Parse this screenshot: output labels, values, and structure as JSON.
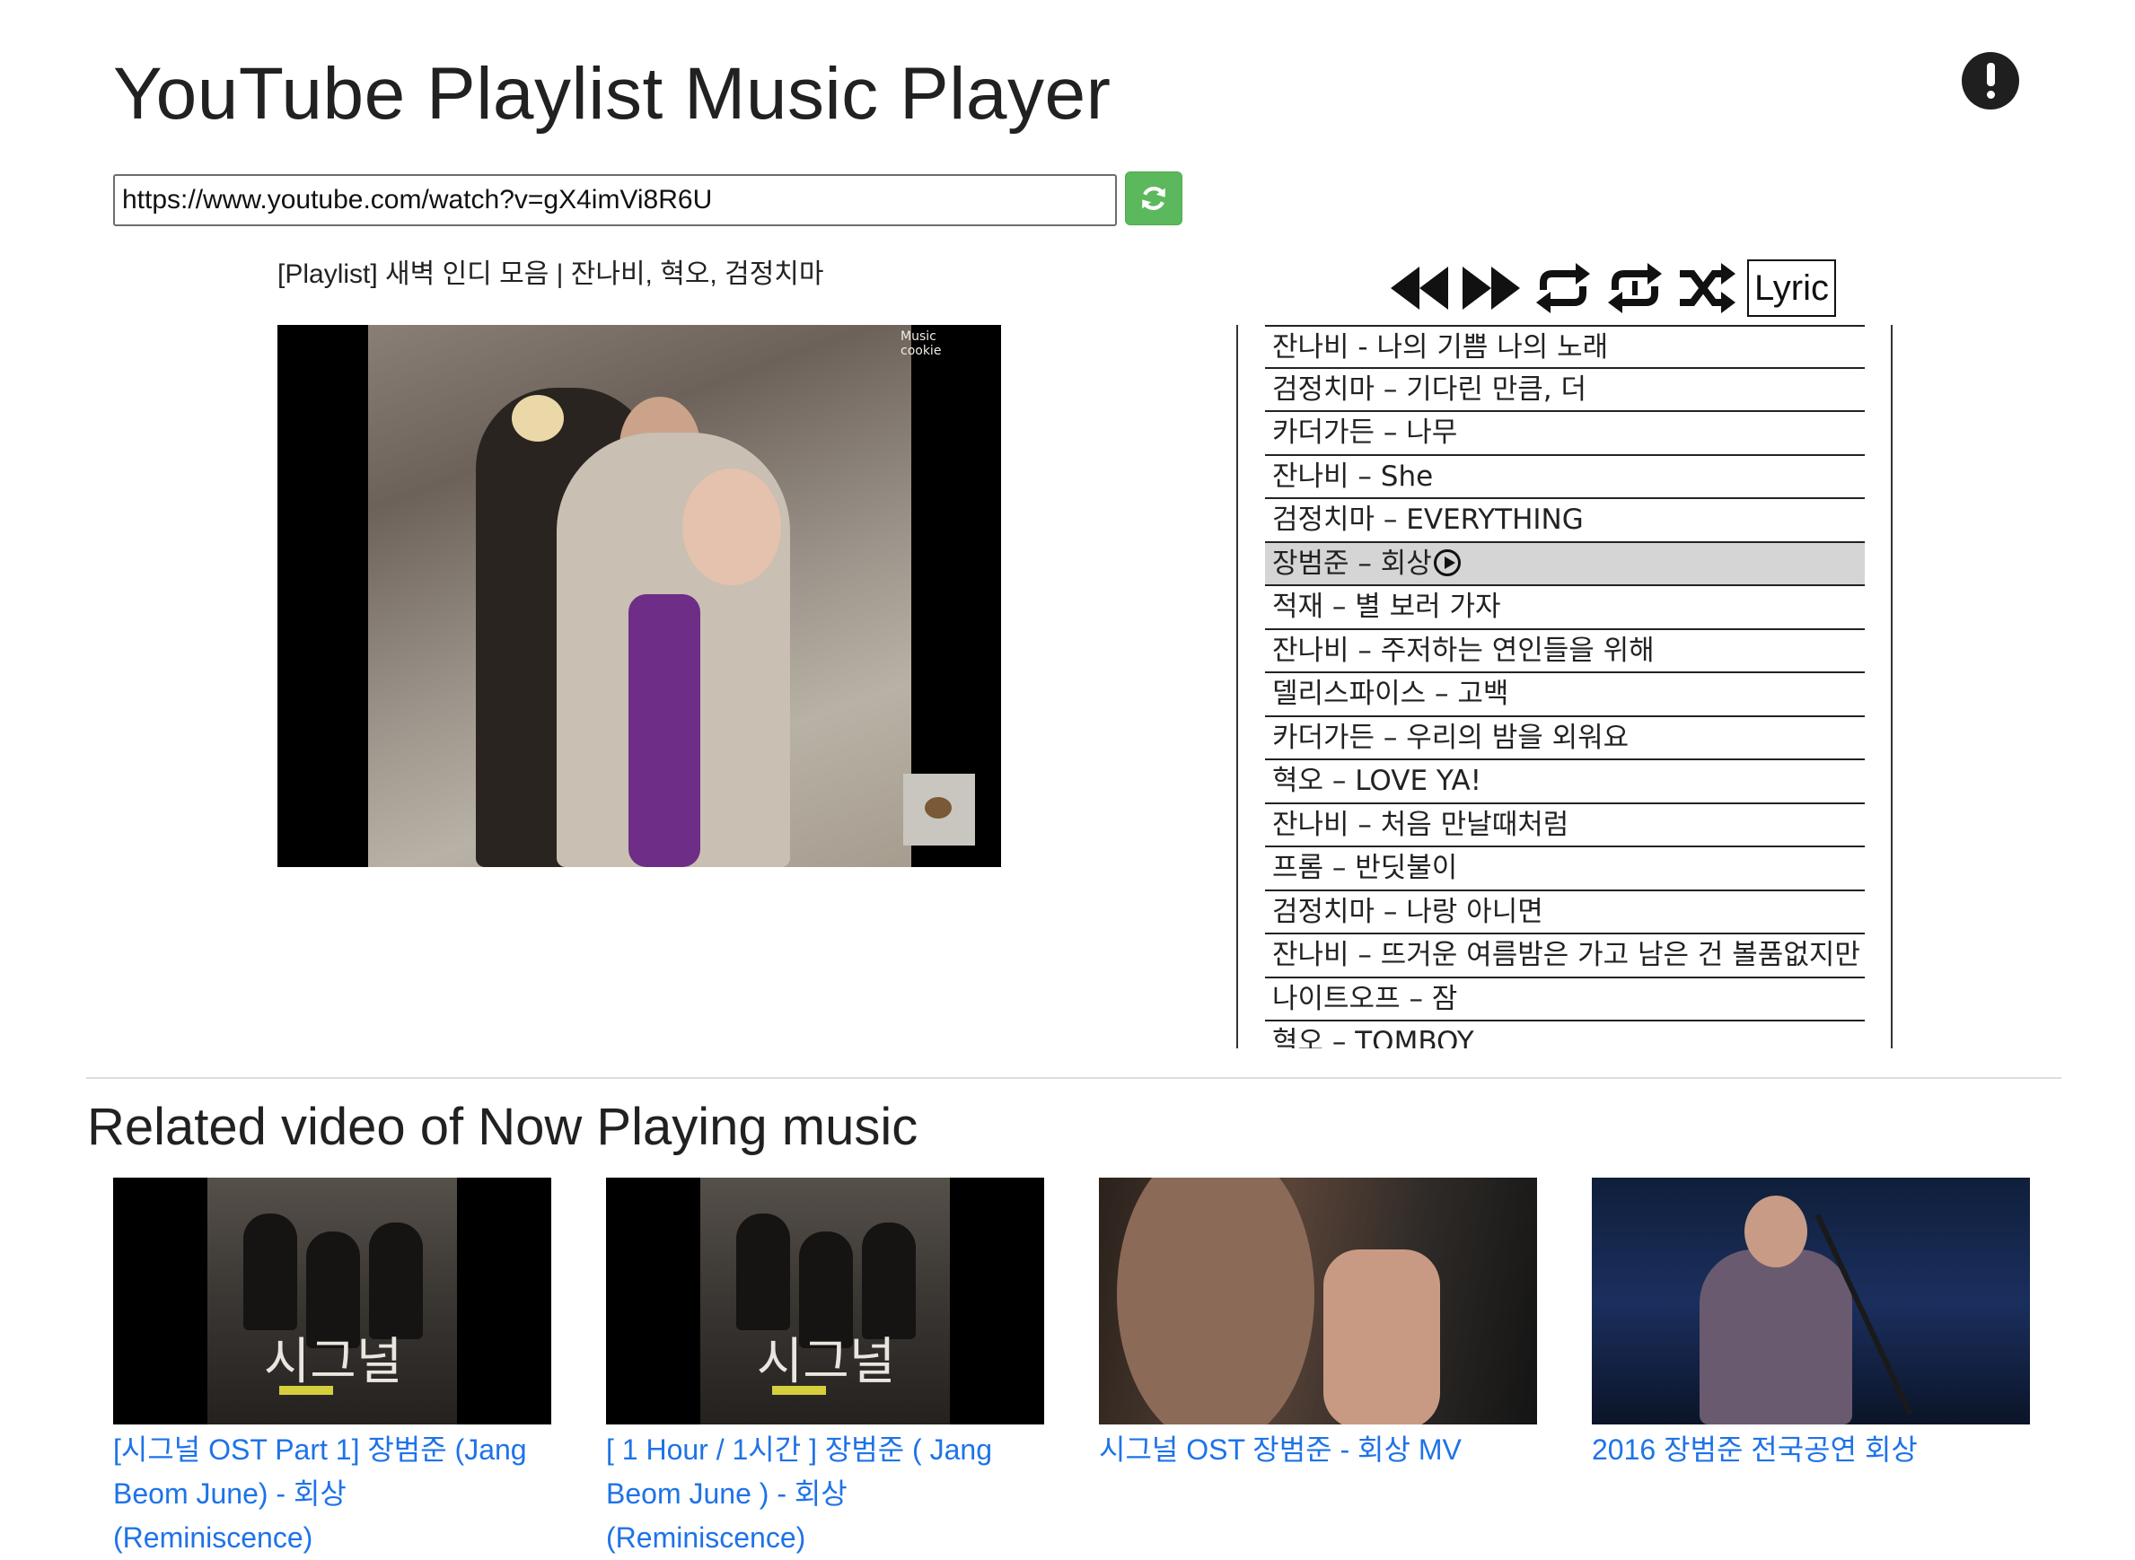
{
  "header": {
    "title": "YouTube Playlist Music Player"
  },
  "url_input": {
    "value": "https://www.youtube.com/watch?v=gX4imVi8R6U"
  },
  "playlist_title": "[Playlist] 새벽 인디 모음 | 잔나비, 혁오, 검정치마",
  "video": {
    "caption": "Music cookie"
  },
  "controls": {
    "lyric_label": "Lyric"
  },
  "playlist": {
    "active_index": 5,
    "tracks": [
      "잔나비 - 나의 기쁨 나의 노래",
      "검정치마 – 기다린 만큼, 더",
      "카더가든 – 나무",
      "잔나비 – She",
      "검정치마 – EVERYTHING",
      "장범준 – 회상",
      "적재 – 별 보러 가자",
      "잔나비 – 주저하는 연인들을 위해",
      "델리스파이스 – 고백",
      "카더가든 – 우리의 밤을 외워요",
      "혁오 – LOVE YA!",
      "잔나비 – 처음 만날때처럼",
      "프롬 – 반딧불이",
      "검정치마 – 나랑 아니면",
      "잔나비 – 뜨거운 여름밤은 가고 남은 건 볼품없지만",
      "나이트오프 – 잠",
      "혁오 – TOMBOY"
    ]
  },
  "related": {
    "heading": "Related video of Now Playing music",
    "videos": [
      {
        "title": "[시그널 OST Part 1] 장범준 (Jang Beom June) - 회상 (Reminiscence)",
        "poster_text": "시그널"
      },
      {
        "title": "[ 1 Hour / 1시간 ] 장범준 ( Jang Beom June ) - 회상 (Reminiscence)",
        "poster_text": "시그널"
      },
      {
        "title": "시그널 OST 장범준 - 회상 MV"
      },
      {
        "title": "2016 장범준 전국공연 회상"
      }
    ]
  },
  "colors": {
    "accent_green": "#5cb85c",
    "link_blue": "#1e73e8",
    "active_row": "#d5d5d5"
  }
}
